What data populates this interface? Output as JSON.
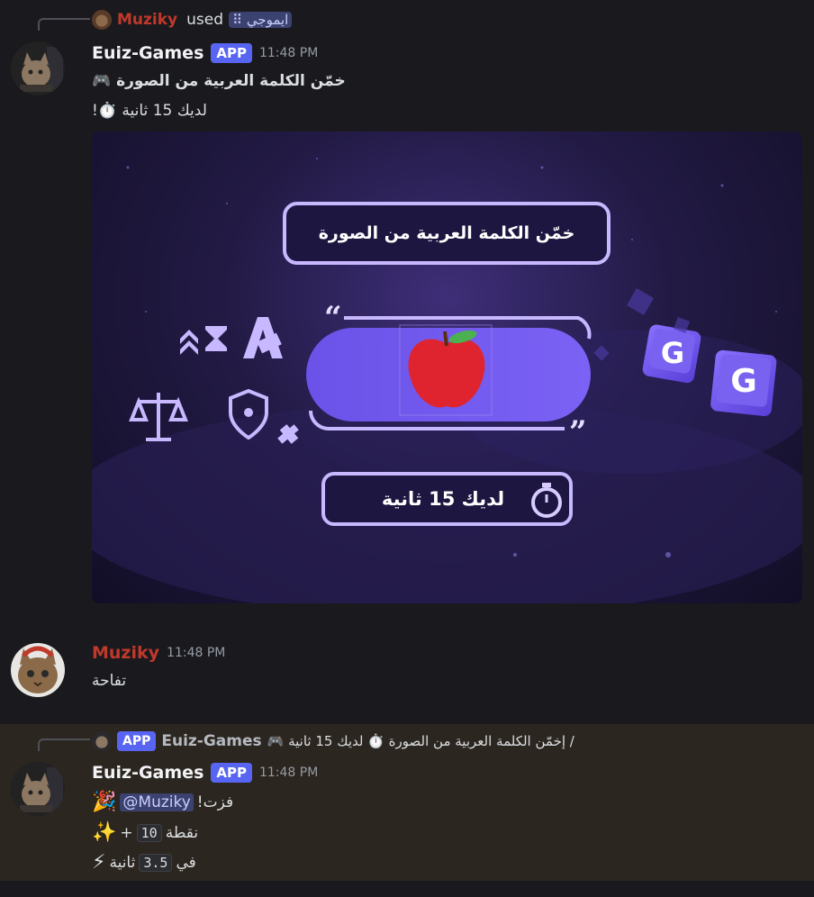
{
  "reply1": {
    "user": "Muziky",
    "used_label": "used",
    "command": "ايموجي"
  },
  "msg1": {
    "author": "Euiz-Games",
    "badge": "APP",
    "time": "11:48 PM",
    "line1": "خمّن الكلمة العربية من الصورة 🎮",
    "line2": "لديك 15 ثانية ⏱️!",
    "image": {
      "title": "خمّن الكلمة العربية من الصورة",
      "timer_text": "لديك 15 ثانية",
      "letter": "G"
    }
  },
  "msg2": {
    "author": "Muziky",
    "time": "11:48 PM",
    "text": "تفاحة"
  },
  "reply2": {
    "badge": "APP",
    "user": "Euiz-Games",
    "text": "/ إخمّن الكلمة العربية من الصورة ⏱️ لديك 15 ثانية 🎮"
  },
  "msg3": {
    "author": "Euiz-Games",
    "badge": "APP",
    "time": "11:48 PM",
    "line1_text": "!فزت",
    "mention": "@Muziky",
    "line2_text": "نقطة",
    "points": "10",
    "line3_prefix": "في",
    "seconds": "3.5",
    "line3_suffix": "ثانية"
  },
  "colors": {
    "accent": "#5865f2",
    "muziky": "#c0392b",
    "highlight": "#2c2620"
  }
}
